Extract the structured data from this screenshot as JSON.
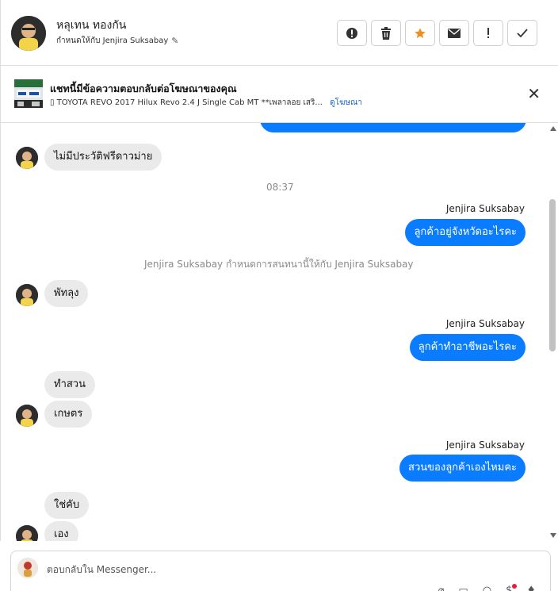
{
  "header": {
    "contact_name": "หลุเทน ทองกัน",
    "assigned_label": "กำหนดให้กับ Jenjira Suksabay",
    "actions": [
      {
        "name": "report-button",
        "icon": "alert-circle-icon"
      },
      {
        "name": "delete-button",
        "icon": "trash-icon"
      },
      {
        "name": "star-button",
        "icon": "star-icon"
      },
      {
        "name": "mark-unread-button",
        "icon": "envelope-icon"
      },
      {
        "name": "spam-button",
        "icon": "exclamation-icon"
      },
      {
        "name": "done-button",
        "icon": "checkmark-icon"
      }
    ],
    "star_color": "#f28b20"
  },
  "ad": {
    "title": "แชทนี้มีข้อความตอบกลับต่อโฆษณาของคุณ",
    "description": "▯ TOYOTA REVO 2017 Hilux Revo 2.4 J Single Cab MT **เพลาลอย เสริ...",
    "link": "ดูโฆษณา"
  },
  "messages": {
    "m1": "ไม่มีประวัติฟรีดาวม่าย",
    "time1": "08:37",
    "sender1": "Jenjira Suksabay",
    "m2": "ลูกค้าอยู่จังหวัดอะไรคะ",
    "system1": "Jenjira Suksabay กำหนดการสนทนานี้ให้กับ Jenjira Suksabay",
    "m3": "พัทลุง",
    "sender2": "Jenjira Suksabay",
    "m4": "ลูกค้าทำอาชีพอะไรคะ",
    "m5": "ทำสวน",
    "m6": "เกษตร",
    "sender3": "Jenjira Suksabay",
    "m7": "สวนของลูกค้าเองไหมคะ",
    "m8": "ใช่คับ",
    "m9": "เอง"
  },
  "composer": {
    "placeholder": "ตอบกลับใน Messenger..."
  },
  "colors": {
    "outgoing_bubble": "#0a7cff",
    "incoming_bubble": "#eaeaea",
    "notification_dot": "#e41e3f"
  }
}
